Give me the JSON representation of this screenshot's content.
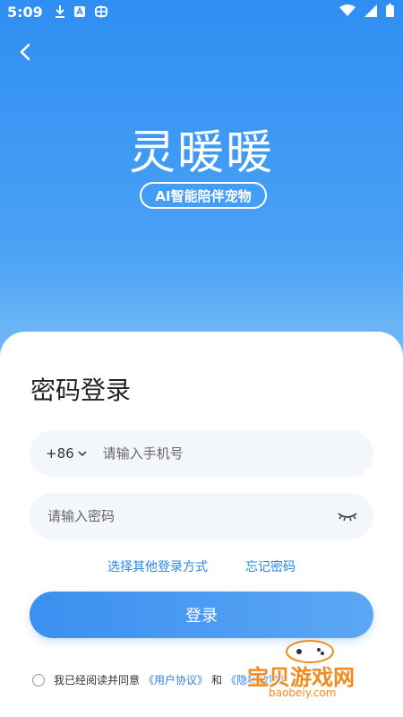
{
  "status_bar": {
    "time": "5:09"
  },
  "header": {
    "logo_text": "灵暖暖",
    "tagline": "AI智能陪伴宠物"
  },
  "login": {
    "title": "密码登录",
    "country_code": "+86",
    "phone_placeholder": "请输入手机号",
    "password_placeholder": "请输入密码",
    "other_login": "选择其他登录方式",
    "forgot_password": "忘记密码",
    "login_button": "登录"
  },
  "agreement": {
    "prefix": "我已经阅读并同意",
    "user_agreement": "《用户协议》",
    "and": "和",
    "privacy_policy": "《隐私政策》"
  },
  "watermark": {
    "name": "宝贝游戏网",
    "url": "baobeiy.com"
  },
  "colors": {
    "primary": "#2a85ea",
    "gradient_top": "#2f8ef2",
    "button_start": "#3b8ff0",
    "button_end": "#5ca7f5"
  }
}
